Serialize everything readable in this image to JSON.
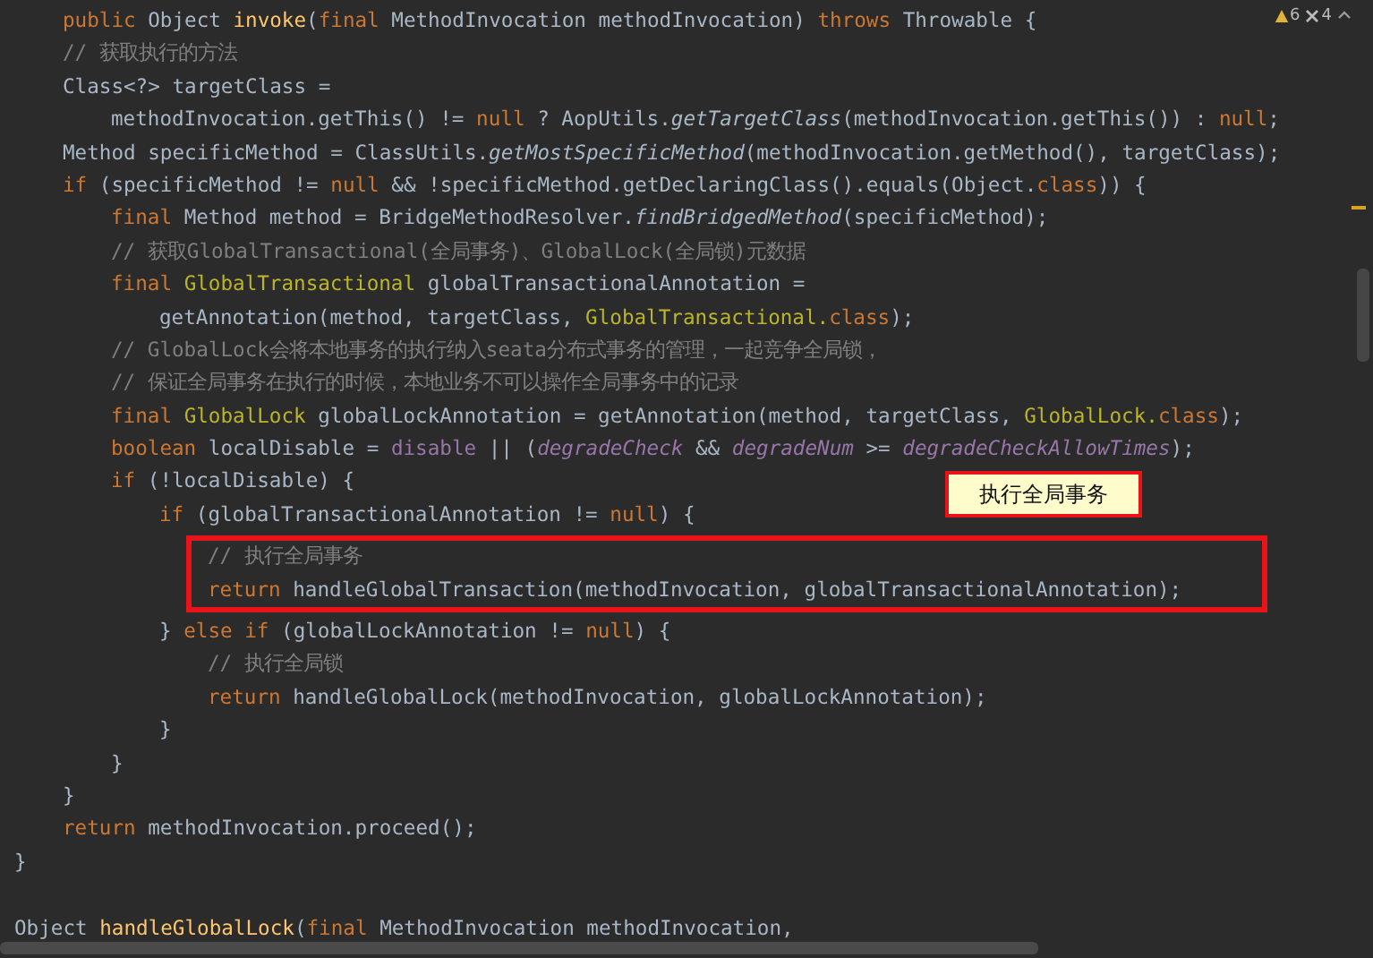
{
  "inspections": [
    {
      "kind": "warning",
      "count": "6"
    },
    {
      "kind": "weak_warning",
      "count": "4"
    }
  ],
  "callout": {
    "text": "执行全局事务"
  },
  "lines": [
    {
      "kind": "group",
      "children": [
        {
          "kind": "code",
          "tokens": [
            {
              "kind": "keyword",
              "text": "public "
            },
            {
              "kind": "plain",
              "text": "Object "
            },
            {
              "kind": "declaration",
              "text": "invoke"
            },
            {
              "kind": "plain",
              "text": "("
            },
            {
              "kind": "keyword",
              "text": "final "
            },
            {
              "kind": "plain",
              "text": "MethodInvocation methodInvocation) "
            },
            {
              "kind": "keyword",
              "text": "throws "
            },
            {
              "kind": "plain",
              "text": "Throwable {"
            }
          ]
        },
        {
          "kind": "code",
          "tokens": [
            {
              "kind": "comment",
              "text": "// 获取执行的方法"
            }
          ]
        },
        {
          "kind": "code",
          "tokens": [
            {
              "kind": "plain",
              "text": "Class<?> targetClass ="
            }
          ],
          "children": [
            {
              "kind": "code",
              "tokens": [
                {
                  "kind": "plain",
                  "text": "methodInvocation.getThis() != "
                },
                {
                  "kind": "keyword",
                  "text": "null"
                },
                {
                  "kind": "plain",
                  "text": " ? AopUtils."
                },
                {
                  "kind": "static_call",
                  "text": "getTargetClass"
                },
                {
                  "kind": "plain",
                  "text": "(methodInvocation.getThis()) : "
                },
                {
                  "kind": "keyword",
                  "text": "null"
                },
                {
                  "kind": "plain",
                  "text": ";"
                }
              ]
            }
          ]
        },
        {
          "kind": "code",
          "tokens": [
            {
              "kind": "plain",
              "text": "Method specificMethod = ClassUtils."
            },
            {
              "kind": "static_call",
              "text": "getMostSpecificMethod"
            },
            {
              "kind": "plain",
              "text": "(methodInvocation.getMethod(), targetClass);"
            }
          ]
        },
        {
          "kind": "code",
          "tokens": [
            {
              "kind": "keyword",
              "text": "if "
            },
            {
              "kind": "plain",
              "text": "(specificMethod != "
            },
            {
              "kind": "keyword",
              "text": "null"
            },
            {
              "kind": "plain",
              "text": " && !specificMethod.getDeclaringClass().equals(Object."
            },
            {
              "kind": "keyword",
              "text": "class"
            },
            {
              "kind": "plain",
              "text": ")) {"
            }
          ],
          "children": [
            {
              "kind": "code",
              "tokens": [
                {
                  "kind": "keyword",
                  "text": "final "
                },
                {
                  "kind": "plain",
                  "text": "Method method = BridgeMethodResolver."
                },
                {
                  "kind": "static_call",
                  "text": "findBridgedMethod"
                },
                {
                  "kind": "plain",
                  "text": "(specificMethod);"
                }
              ]
            },
            {
              "kind": "code",
              "tokens": [
                {
                  "kind": "comment",
                  "text": "// 获取GlobalTransactional(全局事务)、GlobalLock(全局锁)元数据"
                }
              ]
            },
            {
              "kind": "code",
              "tokens": [
                {
                  "kind": "keyword",
                  "text": "final "
                },
                {
                  "kind": "annotation",
                  "text": "GlobalTransactional"
                },
                {
                  "kind": "plain",
                  "text": " globalTransactionalAnnotation ="
                }
              ],
              "children": [
                {
                  "kind": "code",
                  "tokens": [
                    {
                      "kind": "plain",
                      "text": "getAnnotation(method, targetClass, "
                    },
                    {
                      "kind": "annotation",
                      "text": "GlobalTransactional."
                    },
                    {
                      "kind": "keyword",
                      "text": "class"
                    },
                    {
                      "kind": "plain",
                      "text": ");"
                    }
                  ]
                }
              ]
            },
            {
              "kind": "code",
              "tokens": [
                {
                  "kind": "comment",
                  "text": "// GlobalLock会将本地事务的执行纳入seata分布式事务的管理，一起竞争全局锁，"
                }
              ]
            },
            {
              "kind": "code",
              "tokens": [
                {
                  "kind": "comment",
                  "text": "// 保证全局事务在执行的时候，本地业务不可以操作全局事务中的记录"
                }
              ]
            },
            {
              "kind": "code",
              "tokens": [
                {
                  "kind": "keyword",
                  "text": "final "
                },
                {
                  "kind": "annotation",
                  "text": "GlobalLock"
                },
                {
                  "kind": "plain",
                  "text": " globalLockAnnotation = getAnnotation(method, targetClass, "
                },
                {
                  "kind": "annotation",
                  "text": "GlobalLock."
                },
                {
                  "kind": "keyword",
                  "text": "class"
                },
                {
                  "kind": "plain",
                  "text": ");"
                }
              ]
            },
            {
              "kind": "code",
              "tokens": [
                {
                  "kind": "keyword",
                  "text": "boolean "
                },
                {
                  "kind": "plain",
                  "text": "localDisable = "
                },
                {
                  "kind": "field",
                  "text": "disable"
                },
                {
                  "kind": "plain",
                  "text": " || ("
                },
                {
                  "kind": "static_field",
                  "text": "degradeCheck"
                },
                {
                  "kind": "plain",
                  "text": " && "
                },
                {
                  "kind": "static_field",
                  "text": "degradeNum"
                },
                {
                  "kind": "plain",
                  "text": " >= "
                },
                {
                  "kind": "static_field",
                  "text": "degradeCheckAllowTimes"
                },
                {
                  "kind": "plain",
                  "text": ");"
                }
              ]
            },
            {
              "kind": "code",
              "tokens": [
                {
                  "kind": "keyword",
                  "text": "if "
                },
                {
                  "kind": "plain",
                  "text": "(!localDisable) {"
                }
              ],
              "children": [
                {
                  "kind": "code",
                  "tokens": [
                    {
                      "kind": "keyword",
                      "text": "if "
                    },
                    {
                      "kind": "plain",
                      "text": "(globalTransactionalAnnotation != "
                    },
                    {
                      "kind": "keyword",
                      "text": "null"
                    },
                    {
                      "kind": "plain",
                      "text": ") {"
                    }
                  ],
                  "children": [
                    {
                      "kind": "highlight",
                      "children": [
                        {
                          "kind": "code",
                          "tokens": [
                            {
                              "kind": "comment",
                              "text": "// 执行全局事务"
                            }
                          ]
                        },
                        {
                          "kind": "code",
                          "tokens": [
                            {
                              "kind": "keyword",
                              "text": "return "
                            },
                            {
                              "kind": "plain",
                              "text": "handleGlobalTransaction(methodInvocation, globalTransactionalAnnotation);"
                            }
                          ]
                        }
                      ]
                    }
                  ]
                },
                {
                  "kind": "code",
                  "tokens": [
                    {
                      "kind": "plain",
                      "text": "} "
                    },
                    {
                      "kind": "keyword",
                      "text": "else if "
                    },
                    {
                      "kind": "plain",
                      "text": "(globalLockAnnotation != "
                    },
                    {
                      "kind": "keyword",
                      "text": "null"
                    },
                    {
                      "kind": "plain",
                      "text": ") {"
                    }
                  ],
                  "children": [
                    {
                      "kind": "code",
                      "tokens": [
                        {
                          "kind": "comment",
                          "text": "// 执行全局锁"
                        }
                      ]
                    },
                    {
                      "kind": "code",
                      "tokens": [
                        {
                          "kind": "keyword",
                          "text": "return "
                        },
                        {
                          "kind": "plain",
                          "text": "handleGlobalLock(methodInvocation, globalLockAnnotation);"
                        }
                      ]
                    }
                  ]
                },
                {
                  "kind": "code",
                  "tokens": [
                    {
                      "kind": "plain",
                      "text": "}"
                    }
                  ]
                }
              ]
            },
            {
              "kind": "code",
              "tokens": [
                {
                  "kind": "plain",
                  "text": "}"
                }
              ]
            }
          ]
        },
        {
          "kind": "code",
          "tokens": [
            {
              "kind": "plain",
              "text": "}"
            }
          ]
        },
        {
          "kind": "code",
          "tokens": [
            {
              "kind": "keyword",
              "text": "return "
            },
            {
              "kind": "plain",
              "text": "methodInvocation.proceed();"
            }
          ]
        }
      ]
    },
    {
      "kind": "code",
      "tokens": [
        {
          "kind": "plain",
          "text": "}"
        }
      ]
    },
    {
      "kind": "blank"
    },
    {
      "kind": "code",
      "tokens": [
        {
          "kind": "plain",
          "text": "Object "
        },
        {
          "kind": "declaration",
          "text": "handleGlobalLock"
        },
        {
          "kind": "plain",
          "text": "("
        },
        {
          "kind": "keyword",
          "text": "final "
        },
        {
          "kind": "plain",
          "text": "MethodInvocation methodInvocation,"
        }
      ]
    }
  ]
}
